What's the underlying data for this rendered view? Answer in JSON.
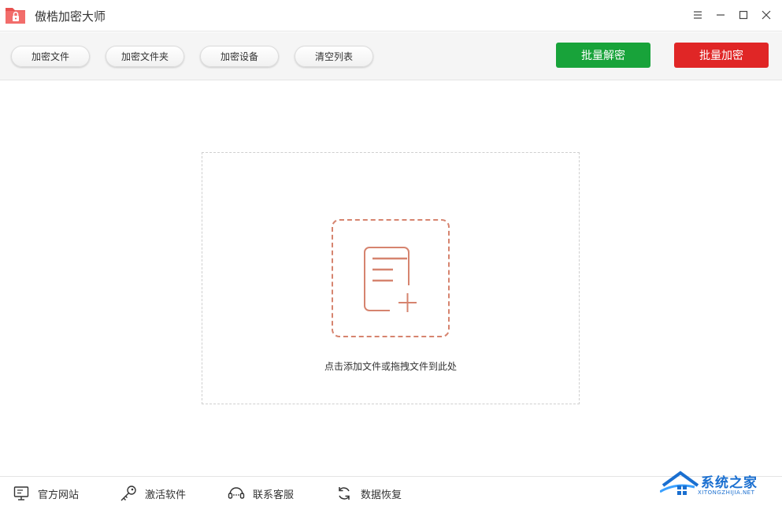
{
  "window": {
    "title": "傲梏加密大师",
    "controls": [
      "menu-icon",
      "minimize-icon",
      "maximize-icon",
      "close-icon"
    ]
  },
  "toolbar": {
    "encrypt_file": "加密文件",
    "encrypt_folder": "加密文件夹",
    "encrypt_device": "加密设备",
    "clear_list": "清空列表",
    "batch_decrypt": "批量解密",
    "batch_encrypt": "批量加密"
  },
  "dropzone": {
    "hint": "点击添加文件或拖拽文件到此处",
    "icon": "add-file-icon"
  },
  "bottombar": {
    "official_site": "官方网站",
    "activate": "激活软件",
    "support": "联系客服",
    "data_recovery": "数据恢复"
  },
  "watermark": {
    "main": "系统之家",
    "sub": "XITONGZHIJIA.NET"
  },
  "colors": {
    "green": "#18a33a",
    "red": "#e02626",
    "accent": "#d6846f",
    "logo": "#e8514f"
  }
}
